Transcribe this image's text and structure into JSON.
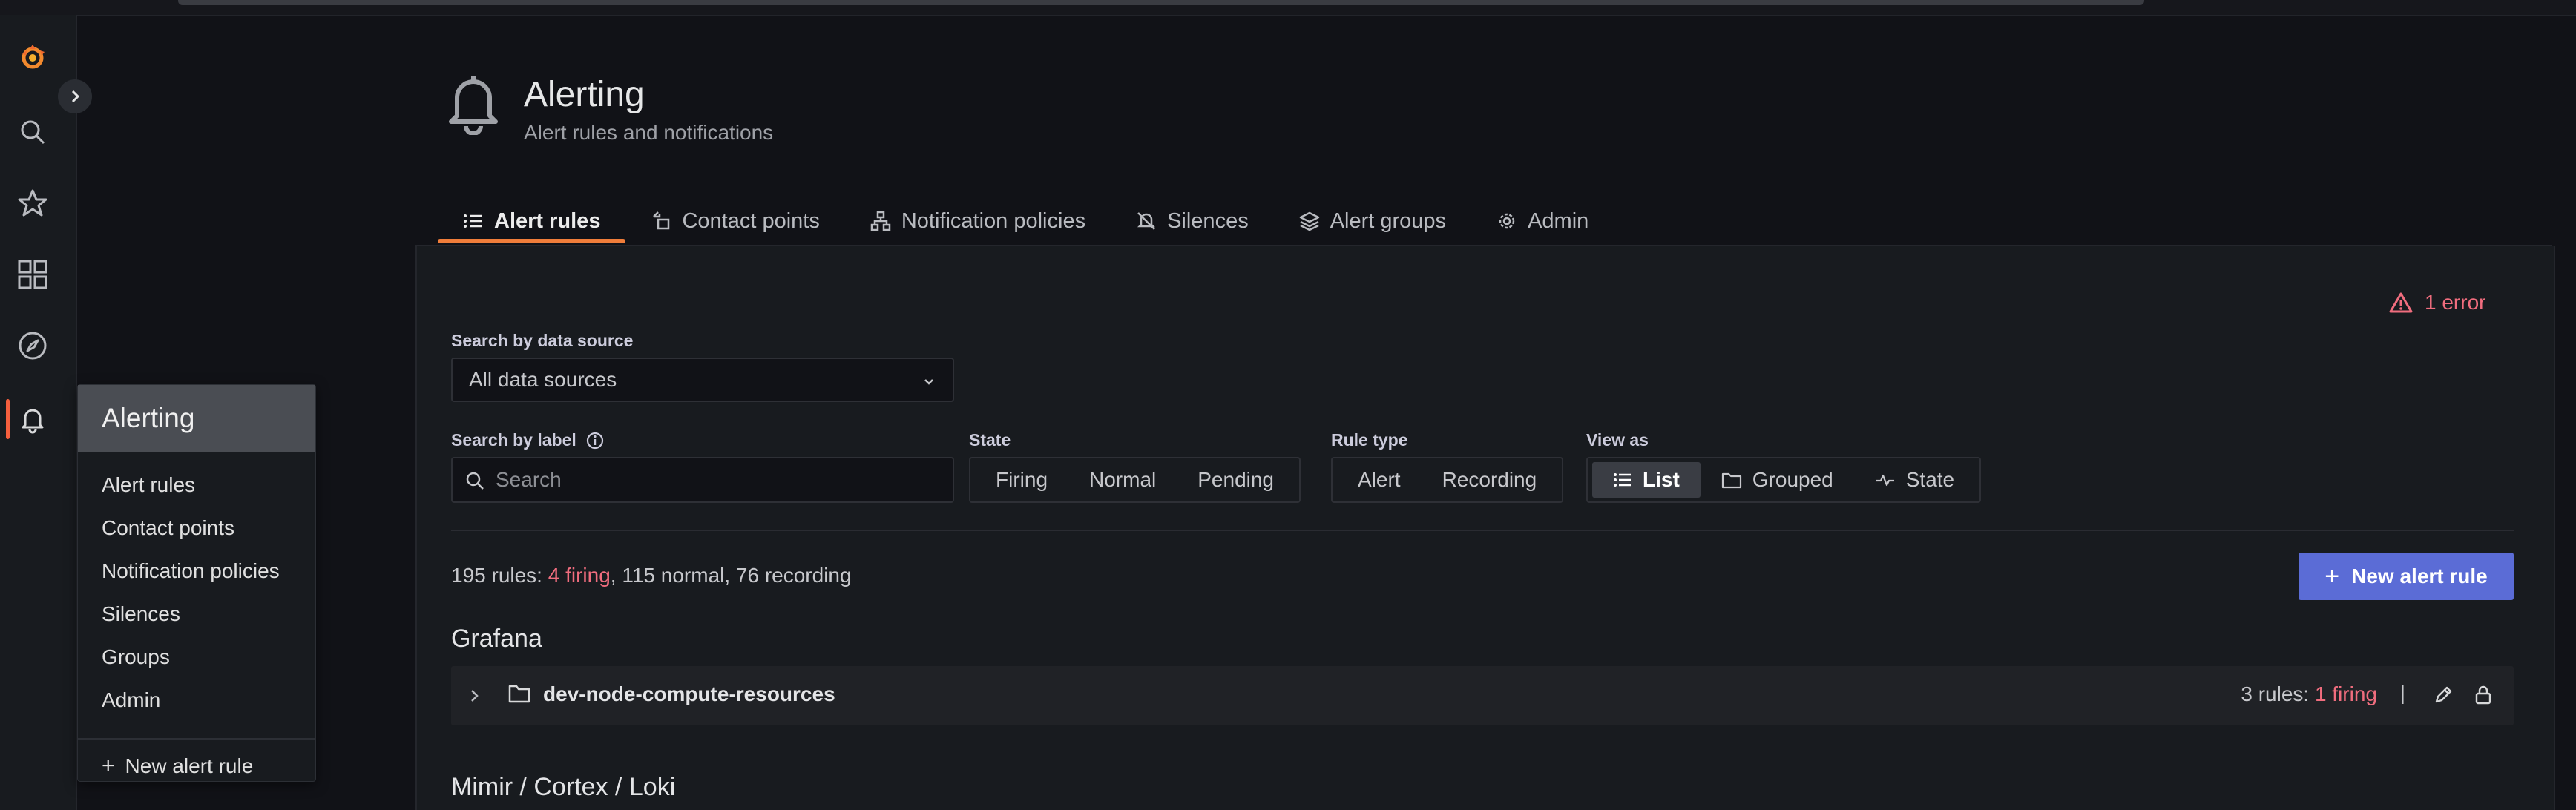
{
  "nav": {
    "rail_icons": [
      "grafana-logo-icon",
      "search-icon",
      "star-icon",
      "dashboards-grid-icon",
      "explore-compass-icon",
      "bell-icon"
    ]
  },
  "flyout": {
    "title": "Alerting",
    "items": [
      "Alert rules",
      "Contact points",
      "Notification policies",
      "Silences",
      "Groups",
      "Admin"
    ],
    "new_rule": "New alert rule"
  },
  "header": {
    "title": "Alerting",
    "subtitle": "Alert rules and notifications"
  },
  "tabs": [
    {
      "label": "Alert rules",
      "icon": "list-icon",
      "active": true
    },
    {
      "label": "Contact points",
      "icon": "contact-icon",
      "active": false
    },
    {
      "label": "Notification policies",
      "icon": "sitemap-icon",
      "active": false
    },
    {
      "label": "Silences",
      "icon": "bell-slash-icon",
      "active": false
    },
    {
      "label": "Alert groups",
      "icon": "layers-icon",
      "active": false
    },
    {
      "label": "Admin",
      "icon": "cog-icon",
      "active": false
    }
  ],
  "error": {
    "text": "1 error"
  },
  "filters": {
    "datasource_label": "Search by data source",
    "datasource_value": "All data sources",
    "label_label": "Search by label",
    "search_placeholder": "Search",
    "state_label": "State",
    "state_options": [
      "Firing",
      "Normal",
      "Pending"
    ],
    "ruletype_label": "Rule type",
    "ruletype_options": [
      "Alert",
      "Recording"
    ],
    "viewas_label": "View as",
    "viewas_options": [
      "List",
      "Grouped",
      "State"
    ],
    "viewas_selected": "List"
  },
  "summary": {
    "prefix": "195 rules: ",
    "firing": "4 firing",
    "rest": ", 115 normal, 76 recording"
  },
  "new_rule_button": "New alert rule",
  "sections": {
    "grafana": "Grafana",
    "mimir": "Mimir / Cortex / Loki"
  },
  "folder": {
    "name": "dev-node-compute-resources",
    "count_prefix": "3 rules: ",
    "count_firing": "1 firing",
    "separator": "|"
  },
  "colors": {
    "accent": "#f07d3a",
    "firing": "#f06d7e",
    "primary": "#5b6cd6"
  }
}
